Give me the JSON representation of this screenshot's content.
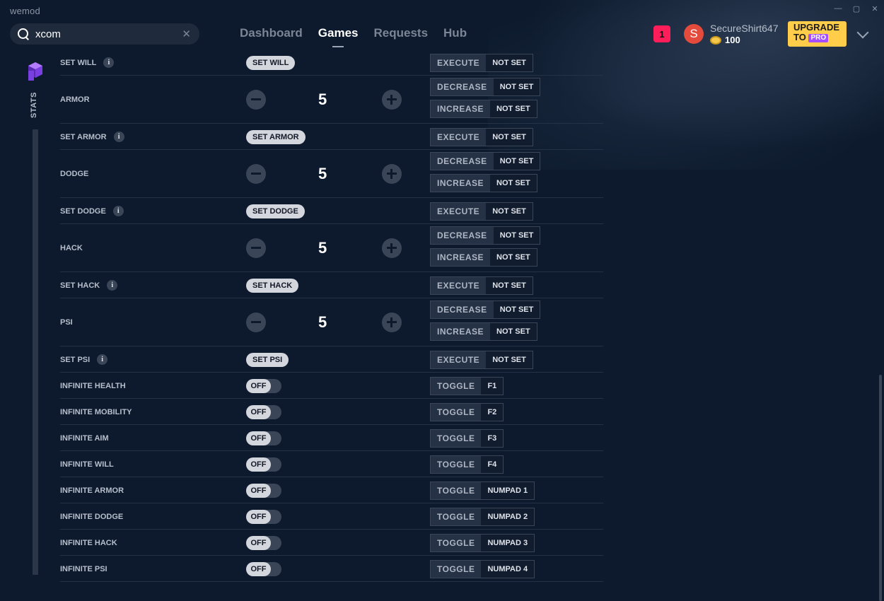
{
  "app": {
    "title": "wemod"
  },
  "window_controls": {
    "minimize": "—",
    "maximize": "▢",
    "close": "✕"
  },
  "search": {
    "value": "xcom",
    "clear": "✕"
  },
  "nav": [
    {
      "label": "Dashboard",
      "active": false
    },
    {
      "label": "Games",
      "active": true
    },
    {
      "label": "Requests",
      "active": false
    },
    {
      "label": "Hub",
      "active": false
    }
  ],
  "header": {
    "notification_count": "1",
    "avatar_letter": "S",
    "username": "SecureShirt647",
    "coins": "100",
    "upgrade_line1": "UPGRADE",
    "upgrade_to": "TO",
    "upgrade_pro": "PRO"
  },
  "sidebar": {
    "stats_label": "STATS"
  },
  "rows": [
    {
      "type": "set",
      "label": "SET WILL",
      "button": "SET WILL",
      "hotkeys": [
        {
          "action": "EXECUTE",
          "key": "NOT SET"
        }
      ]
    },
    {
      "type": "stepper",
      "label": "ARMOR",
      "value": "5",
      "hotkeys": [
        {
          "action": "DECREASE",
          "key": "NOT SET"
        },
        {
          "action": "INCREASE",
          "key": "NOT SET"
        }
      ]
    },
    {
      "type": "set",
      "label": "SET ARMOR",
      "button": "SET ARMOR",
      "hotkeys": [
        {
          "action": "EXECUTE",
          "key": "NOT SET"
        }
      ]
    },
    {
      "type": "stepper",
      "label": "DODGE",
      "value": "5",
      "hotkeys": [
        {
          "action": "DECREASE",
          "key": "NOT SET"
        },
        {
          "action": "INCREASE",
          "key": "NOT SET"
        }
      ]
    },
    {
      "type": "set",
      "label": "SET DODGE",
      "button": "SET DODGE",
      "hotkeys": [
        {
          "action": "EXECUTE",
          "key": "NOT SET"
        }
      ]
    },
    {
      "type": "stepper",
      "label": "HACK",
      "value": "5",
      "hotkeys": [
        {
          "action": "DECREASE",
          "key": "NOT SET"
        },
        {
          "action": "INCREASE",
          "key": "NOT SET"
        }
      ]
    },
    {
      "type": "set",
      "label": "SET HACK",
      "button": "SET HACK",
      "hotkeys": [
        {
          "action": "EXECUTE",
          "key": "NOT SET"
        }
      ]
    },
    {
      "type": "stepper",
      "label": "PSI",
      "value": "5",
      "hotkeys": [
        {
          "action": "DECREASE",
          "key": "NOT SET"
        },
        {
          "action": "INCREASE",
          "key": "NOT SET"
        }
      ]
    },
    {
      "type": "set",
      "label": "SET PSI",
      "button": "SET PSI",
      "hotkeys": [
        {
          "action": "EXECUTE",
          "key": "NOT SET"
        }
      ]
    },
    {
      "type": "toggle",
      "label": "INFINITE HEALTH",
      "state": "OFF",
      "hotkeys": [
        {
          "action": "TOGGLE",
          "key": "F1"
        }
      ]
    },
    {
      "type": "toggle",
      "label": "INFINITE MOBILITY",
      "state": "OFF",
      "hotkeys": [
        {
          "action": "TOGGLE",
          "key": "F2"
        }
      ]
    },
    {
      "type": "toggle",
      "label": "INFINITE AIM",
      "state": "OFF",
      "hotkeys": [
        {
          "action": "TOGGLE",
          "key": "F3"
        }
      ]
    },
    {
      "type": "toggle",
      "label": "INFINITE WILL",
      "state": "OFF",
      "hotkeys": [
        {
          "action": "TOGGLE",
          "key": "F4"
        }
      ]
    },
    {
      "type": "toggle",
      "label": "INFINITE ARMOR",
      "state": "OFF",
      "hotkeys": [
        {
          "action": "TOGGLE",
          "key": "NUMPAD 1"
        }
      ]
    },
    {
      "type": "toggle",
      "label": "INFINITE DODGE",
      "state": "OFF",
      "hotkeys": [
        {
          "action": "TOGGLE",
          "key": "NUMPAD 2"
        }
      ]
    },
    {
      "type": "toggle",
      "label": "INFINITE HACK",
      "state": "OFF",
      "hotkeys": [
        {
          "action": "TOGGLE",
          "key": "NUMPAD 3"
        }
      ]
    },
    {
      "type": "toggle",
      "label": "INFINITE PSI",
      "state": "OFF",
      "hotkeys": [
        {
          "action": "TOGGLE",
          "key": "NUMPAD 4"
        }
      ]
    }
  ]
}
